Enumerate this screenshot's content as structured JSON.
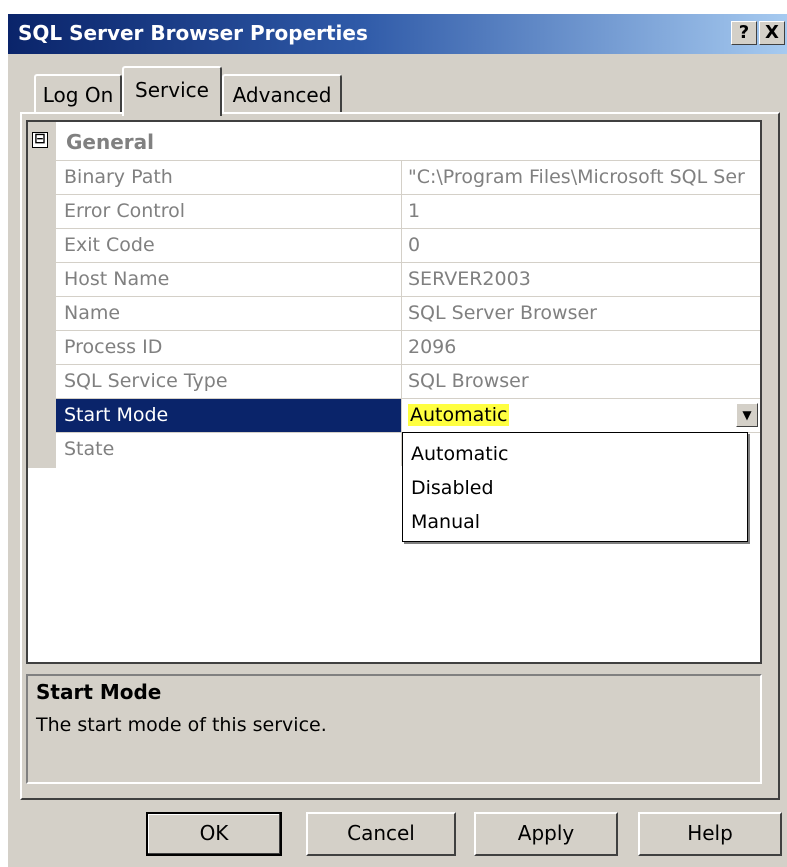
{
  "window": {
    "title": "SQL Server Browser Properties",
    "help_button": "?",
    "close_button": "X"
  },
  "tabs": [
    {
      "label": "Log On",
      "selected": false
    },
    {
      "label": "Service",
      "selected": true
    },
    {
      "label": "Advanced",
      "selected": false
    }
  ],
  "property_grid": {
    "category": {
      "expander": "⊟",
      "label": "General"
    },
    "rows": [
      {
        "name": "Binary Path",
        "value": "\"C:\\Program Files\\Microsoft SQL Ser"
      },
      {
        "name": "Error Control",
        "value": "1"
      },
      {
        "name": "Exit Code",
        "value": "0"
      },
      {
        "name": "Host Name",
        "value": "SERVER2003"
      },
      {
        "name": "Name",
        "value": "SQL Server Browser"
      },
      {
        "name": "Process ID",
        "value": "2096"
      },
      {
        "name": "SQL Service Type",
        "value": "SQL Browser"
      },
      {
        "name": "Start Mode",
        "value": "Automatic",
        "selected": true
      },
      {
        "name": "State",
        "value": ""
      }
    ],
    "dropdown_options": [
      "Automatic",
      "Disabled",
      "Manual"
    ]
  },
  "description": {
    "title": "Start Mode",
    "text": "The start mode of this service."
  },
  "buttons": {
    "ok": "OK",
    "cancel": "Cancel",
    "apply": "Apply",
    "help": "Help"
  },
  "colors": {
    "selection": "#0a246a",
    "highlight": "#ffff40",
    "dialog_face": "#d4d0c8"
  }
}
